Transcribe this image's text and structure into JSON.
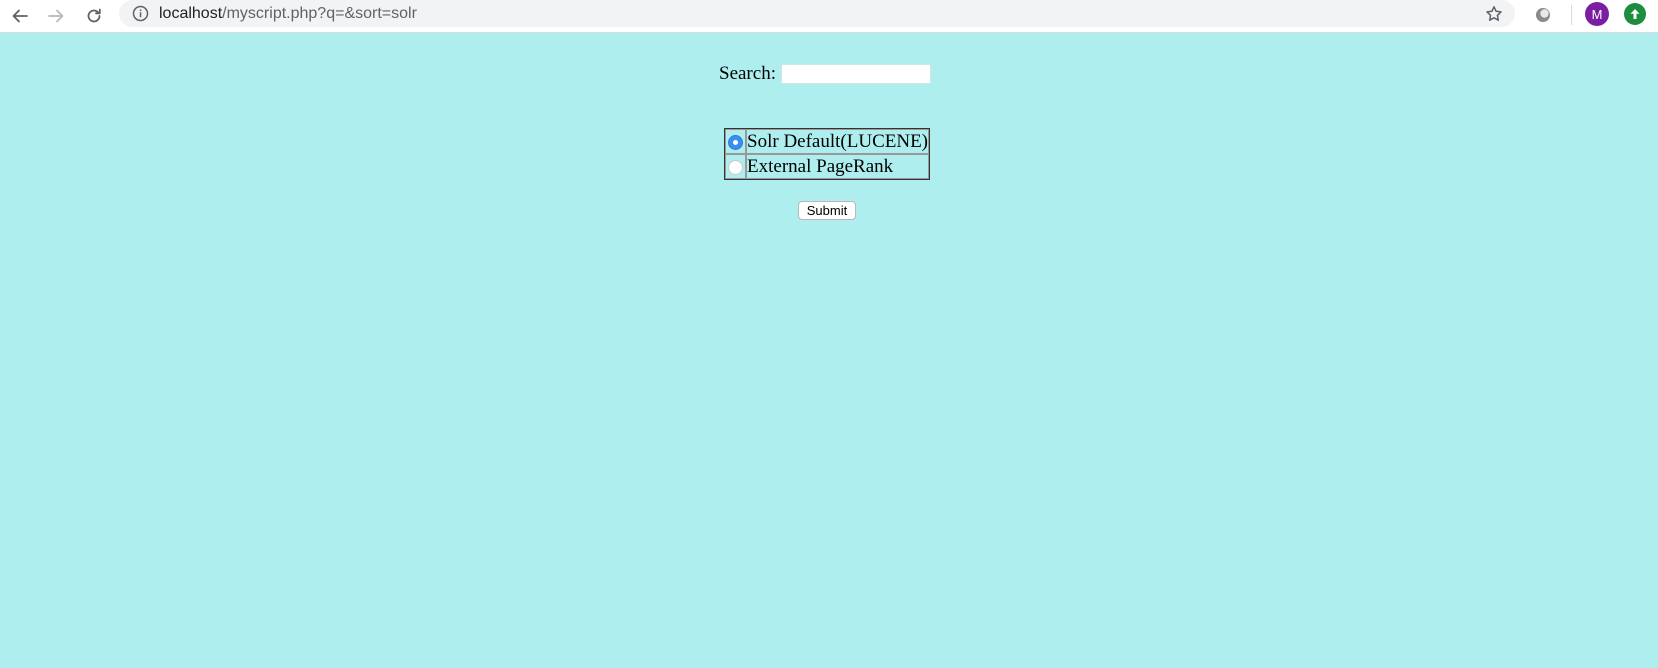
{
  "browser": {
    "url_host": "localhost",
    "url_path": "/myscript.php?q=&sort=solr",
    "avatar_letter": "M",
    "icons": {
      "back": "arrow-left-icon",
      "forward": "arrow-right-icon",
      "reload": "reload-icon",
      "info": "info-icon",
      "bookmark": "star-icon",
      "extension": "extension-icon",
      "update": "update-arrow-icon"
    }
  },
  "page": {
    "background": "#afeeee",
    "search_label": "Search:",
    "search_value": "",
    "sort_options": [
      {
        "label": "Solr Default(LUCENE)",
        "selected": true
      },
      {
        "label": "External PageRank",
        "selected": false
      }
    ],
    "submit_label": "Submit",
    "accent": "#3b8ef0"
  }
}
